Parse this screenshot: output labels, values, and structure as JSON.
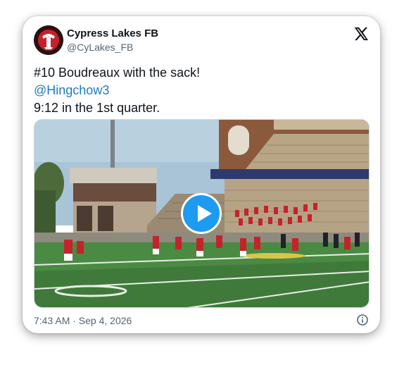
{
  "tweet": {
    "display_name": "Cypress Lakes FB",
    "handle": "@CyLakes_FB",
    "line1": "#10 Boudreaux with the sack!",
    "mention": "@Hingchow3",
    "line3": "9:12 in the 1st quarter.",
    "timestamp": "7:43 AM · Sep 4, 2026"
  },
  "icons": {
    "platform": "x-logo-icon",
    "play": "play-icon",
    "info": "info-icon"
  },
  "colors": {
    "mention": "#1d7cc2",
    "play_button": "#1d9bf0",
    "secondary_text": "#536471"
  }
}
